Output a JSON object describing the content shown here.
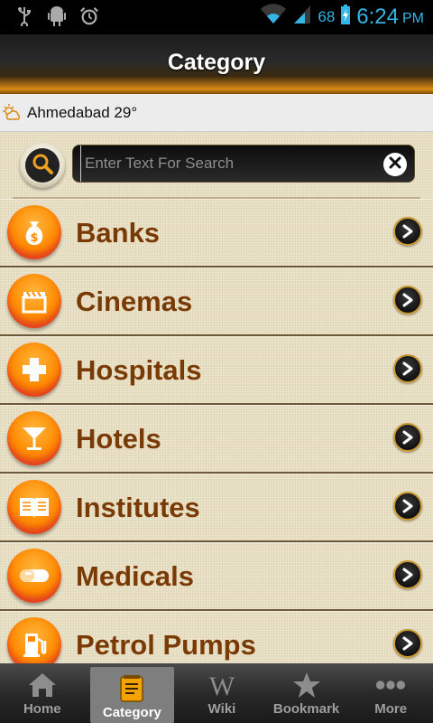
{
  "status_bar": {
    "battery_percent": "68",
    "time": "6:24",
    "ampm": "PM",
    "icons": [
      "usb-icon",
      "android-icon",
      "alarm-icon",
      "wifi-icon",
      "signal-icon",
      "battery-charging-icon"
    ]
  },
  "header": {
    "title": "Category"
  },
  "weather": {
    "text": "Ahmedabad 29°",
    "icon": "partly-cloudy-icon"
  },
  "search": {
    "placeholder": "Enter Text For Search",
    "value": ""
  },
  "categories": [
    {
      "label": "Banks",
      "icon": "money-bag-icon"
    },
    {
      "label": "Cinemas",
      "icon": "clapperboard-icon"
    },
    {
      "label": "Hospitals",
      "icon": "cross-icon"
    },
    {
      "label": "Hotels",
      "icon": "cocktail-glass-icon"
    },
    {
      "label": "Institutes",
      "icon": "book-icon"
    },
    {
      "label": "Medicals",
      "icon": "pill-icon"
    },
    {
      "label": "Petrol Pumps",
      "icon": "fuel-pump-icon"
    }
  ],
  "bottom_nav": [
    {
      "label": "Home",
      "icon": "home-icon",
      "active": false
    },
    {
      "label": "Category",
      "icon": "notepad-icon",
      "active": true
    },
    {
      "label": "Wiki",
      "icon": "wikipedia-icon",
      "active": false
    },
    {
      "label": "Bookmark",
      "icon": "star-icon",
      "active": false
    },
    {
      "label": "More",
      "icon": "more-dots-icon",
      "active": false
    }
  ],
  "colors": {
    "accent_blue": "#33b5e5",
    "category_text": "#7a3a05",
    "icon_orange": "#ff8a00",
    "background": "#e8dfc3"
  }
}
